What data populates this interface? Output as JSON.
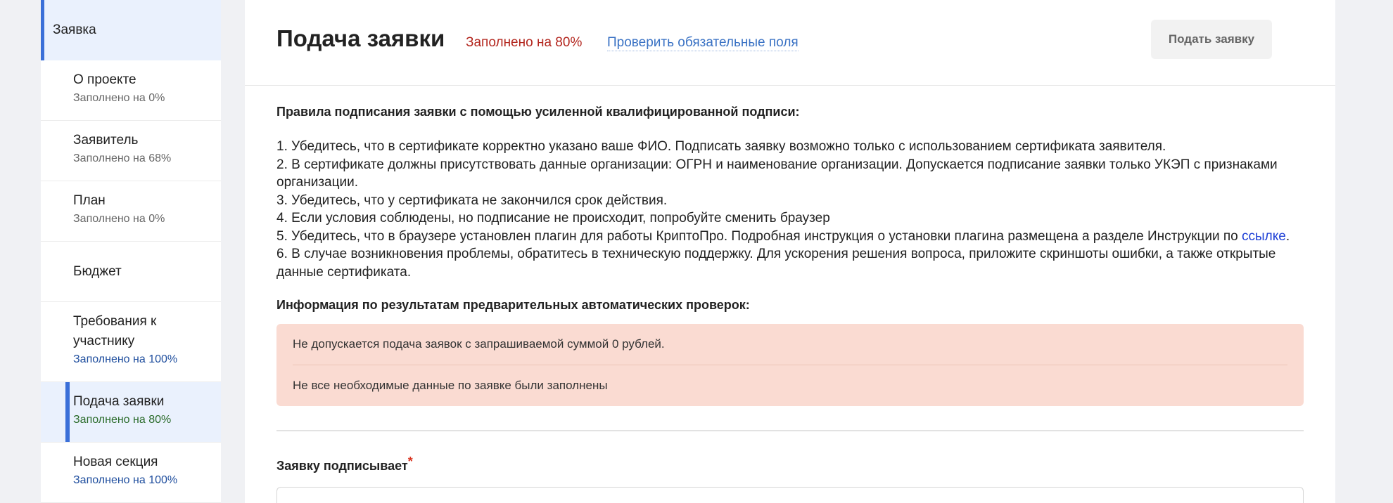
{
  "sidebar": {
    "root_label": "Заявка",
    "items": [
      {
        "title": "О проекте",
        "status": "Заполнено на 0%"
      },
      {
        "title": "Заявитель",
        "status": "Заполнено на 68%"
      },
      {
        "title": "План",
        "status": "Заполнено на 0%"
      },
      {
        "title": "Бюджет",
        "status": ""
      },
      {
        "title": "Требования к участнику",
        "status": "Заполнено на 100%"
      },
      {
        "title": "Подача заявки",
        "status": "Заполнено на 80%"
      },
      {
        "title": "Новая секция",
        "status": "Заполнено на 100%"
      }
    ]
  },
  "header": {
    "title": "Подача заявки",
    "progress": "Заполнено на 80%",
    "check_link": "Проверить обязательные поля",
    "submit_label": "Подать заявку"
  },
  "rules": {
    "heading": "Правила подписания заявки с помощью усиленной квалифицированной подписи:",
    "items": [
      "1. Убедитесь, что в сертификате корректно указано ваше ФИО. Подписать заявку возможно только с использованием сертификата заявителя.",
      "2. В сертификате должны присутствовать данные организации: ОГРН и наименование организации. Допускается подписание заявки только УКЭП с признаками организации.",
      "3. Убедитесь, что у сертификата не закончился срок действия.",
      "4. Если условия соблюдены, но подписание не происходит, попробуйте сменить браузер",
      "5. Убедитесь, что в браузере установлен плагин для работы КриптоПро. Подробная инструкция о установки плагина размещена а разделе Инструкции по",
      "6. В случае возникновения проблемы, обратитесь в техническую поддержку. Для ускорения решения вопроса, приложите скриншоты ошибки, а также открытые данные сертификата."
    ],
    "link_text": "ссылке",
    "link_suffix": "."
  },
  "checks": {
    "heading": "Информация по результатам предварительных автоматических проверок:",
    "messages": [
      "Не допускается подача заявок с запрашиваемой суммой 0 рублей.",
      "Не все необходимые данные по заявке были заполнены"
    ]
  },
  "signer": {
    "label": "Заявку подписывает",
    "required_mark": "*"
  },
  "colors": {
    "accent": "#3a6fd8",
    "progress_red": "#b3261e",
    "alert_bg": "#fadbd2",
    "link_blue": "#1d3fd6"
  }
}
